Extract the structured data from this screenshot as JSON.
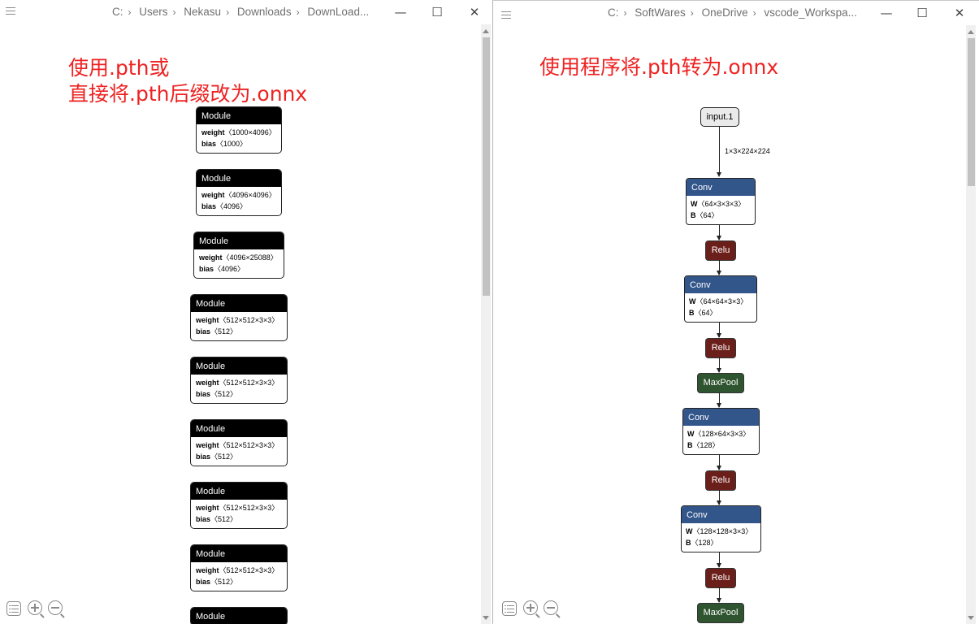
{
  "left_window": {
    "breadcrumb": [
      "C:",
      "Users",
      "Nekasu",
      "Downloads",
      "DownLoad..."
    ],
    "annotation": [
      "使用.pth或",
      "直接将.pth后缀改为.onnx"
    ],
    "modules": [
      {
        "title": "Module",
        "attrs": [
          {
            "name": "weight",
            "value": "〈1000×4096〉"
          },
          {
            "name": "bias",
            "value": "〈1000〉"
          }
        ]
      },
      {
        "title": "Module",
        "attrs": [
          {
            "name": "weight",
            "value": "〈4096×4096〉"
          },
          {
            "name": "bias",
            "value": "〈4096〉"
          }
        ]
      },
      {
        "title": "Module",
        "attrs": [
          {
            "name": "weight",
            "value": "〈4096×25088〉"
          },
          {
            "name": "bias",
            "value": "〈4096〉"
          }
        ]
      },
      {
        "title": "Module",
        "attrs": [
          {
            "name": "weight",
            "value": "〈512×512×3×3〉"
          },
          {
            "name": "bias",
            "value": "〈512〉"
          }
        ]
      },
      {
        "title": "Module",
        "attrs": [
          {
            "name": "weight",
            "value": "〈512×512×3×3〉"
          },
          {
            "name": "bias",
            "value": "〈512〉"
          }
        ]
      },
      {
        "title": "Module",
        "attrs": [
          {
            "name": "weight",
            "value": "〈512×512×3×3〉"
          },
          {
            "name": "bias",
            "value": "〈512〉"
          }
        ]
      },
      {
        "title": "Module",
        "attrs": [
          {
            "name": "weight",
            "value": "〈512×512×3×3〉"
          },
          {
            "name": "bias",
            "value": "〈512〉"
          }
        ]
      },
      {
        "title": "Module",
        "attrs": [
          {
            "name": "weight",
            "value": "〈512×512×3×3〉"
          },
          {
            "name": "bias",
            "value": "〈512〉"
          }
        ]
      },
      {
        "title": "Module",
        "attrs": []
      }
    ]
  },
  "right_window": {
    "breadcrumb": [
      "C:",
      "SoftWares",
      "OneDrive",
      "vscode_Workspa..."
    ],
    "annotation": "使用程序将.pth转为.onnx",
    "input_node": "input.1",
    "input_shape": "1×3×224×224",
    "graph": [
      {
        "type": "Conv",
        "attrs": [
          {
            "name": "W",
            "value": "〈64×3×3×3〉"
          },
          {
            "name": "B",
            "value": "〈64〉"
          }
        ]
      },
      {
        "type": "Relu"
      },
      {
        "type": "Conv",
        "attrs": [
          {
            "name": "W",
            "value": "〈64×64×3×3〉"
          },
          {
            "name": "B",
            "value": "〈64〉"
          }
        ]
      },
      {
        "type": "Relu"
      },
      {
        "type": "MaxPool"
      },
      {
        "type": "Conv",
        "attrs": [
          {
            "name": "W",
            "value": "〈128×64×3×3〉"
          },
          {
            "name": "B",
            "value": "〈128〉"
          }
        ]
      },
      {
        "type": "Relu"
      },
      {
        "type": "Conv",
        "attrs": [
          {
            "name": "W",
            "value": "〈128×128×3×3〉"
          },
          {
            "name": "B",
            "value": "〈128〉"
          }
        ]
      },
      {
        "type": "Relu"
      },
      {
        "type": "MaxPool"
      }
    ]
  },
  "colors": {
    "annotation": "#ee2222",
    "module_header": "#000000",
    "conv_header": "#32558a",
    "relu": "#6b1f1a",
    "maxpool": "#2f5530"
  },
  "icons": {
    "window_menu": "hamburger-icon",
    "minimize": "minimize-icon",
    "maximize": "maximize-icon",
    "close": "close-icon",
    "toolbar": [
      "properties-list-icon",
      "zoom-in-icon",
      "zoom-out-icon"
    ]
  }
}
